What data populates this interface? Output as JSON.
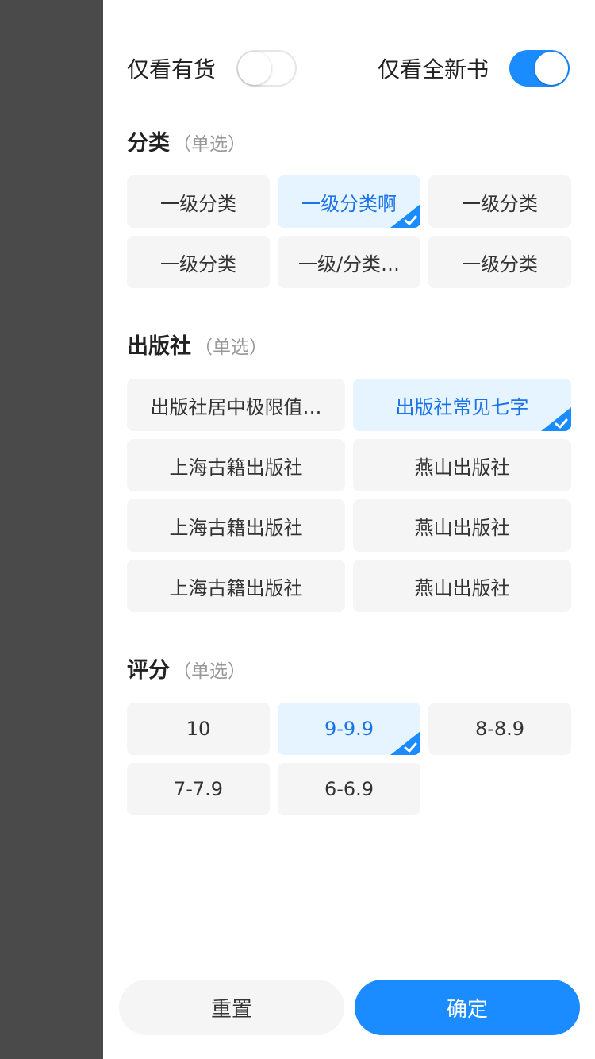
{
  "switches": {
    "in_stock": {
      "label": "仅看有货",
      "on": false
    },
    "new_only": {
      "label": "仅看全新书",
      "on": true
    }
  },
  "category": {
    "title": "分类",
    "hint": "（单选）",
    "options": [
      {
        "label": "一级分类",
        "selected": false
      },
      {
        "label": "一级分类啊",
        "selected": true
      },
      {
        "label": "一级分类",
        "selected": false
      },
      {
        "label": "一级分类",
        "selected": false
      },
      {
        "label": "一级/分类…",
        "selected": false
      },
      {
        "label": "一级分类",
        "selected": false
      }
    ]
  },
  "publisher": {
    "title": "出版社",
    "hint": "（单选）",
    "options": [
      {
        "label": "出版社居中极限值…",
        "selected": false
      },
      {
        "label": "出版社常见七字",
        "selected": true
      },
      {
        "label": "上海古籍出版社",
        "selected": false
      },
      {
        "label": "燕山出版社",
        "selected": false
      },
      {
        "label": "上海古籍出版社",
        "selected": false
      },
      {
        "label": "燕山出版社",
        "selected": false
      },
      {
        "label": "上海古籍出版社",
        "selected": false
      },
      {
        "label": "燕山出版社",
        "selected": false
      }
    ]
  },
  "rating": {
    "title": "评分",
    "hint": "（单选）",
    "options": [
      {
        "label": "10",
        "selected": false
      },
      {
        "label": "9-9.9",
        "selected": true
      },
      {
        "label": "8-8.9",
        "selected": false
      },
      {
        "label": "7-7.9",
        "selected": false
      },
      {
        "label": "6-6.9",
        "selected": false
      }
    ]
  },
  "actions": {
    "reset_label": "重置",
    "confirm_label": "确定"
  },
  "colors": {
    "accent": "#1a8cff",
    "selected_bg": "#e6f4ff",
    "selected_text": "#1a73e8",
    "chip_bg": "#f5f5f5",
    "scrim": "#4a4a4a"
  },
  "icons": {
    "selected_corner": "check-icon"
  }
}
